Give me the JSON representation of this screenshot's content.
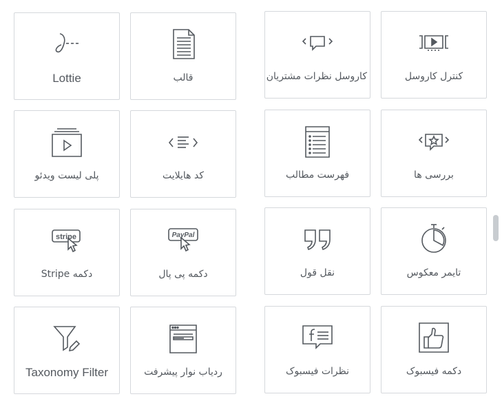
{
  "widgets": [
    {
      "label": "Lottie",
      "icon": "lottie-icon",
      "lang": "en"
    },
    {
      "label": "قالب",
      "icon": "document-icon",
      "lang": "fa"
    },
    {
      "label": "کاروسل نظرات مشتریان",
      "icon": "testimonial-carousel-icon",
      "lang": "fa"
    },
    {
      "label": "کنترل کاروسل",
      "icon": "media-carousel-icon",
      "lang": "fa"
    },
    {
      "label": "پلی لیست ویدئو",
      "icon": "video-playlist-icon",
      "lang": "fa"
    },
    {
      "label": "کد هایلایت",
      "icon": "code-highlight-icon",
      "lang": "fa"
    },
    {
      "label": "فهرست مطالب",
      "icon": "table-of-contents-icon",
      "lang": "fa"
    },
    {
      "label": "بررسی ها",
      "icon": "reviews-icon",
      "lang": "fa"
    },
    {
      "label": "دکمه Stripe",
      "icon": "stripe-button-icon",
      "lang": "fa",
      "badge": "stripe"
    },
    {
      "label": "دکمه پی پال",
      "icon": "paypal-button-icon",
      "lang": "fa",
      "badge": "PayPal"
    },
    {
      "label": "نقل قول",
      "icon": "blockquote-icon",
      "lang": "fa"
    },
    {
      "label": "تایمر معکوس",
      "icon": "countdown-timer-icon",
      "lang": "fa"
    },
    {
      "label": "Taxonomy Filter",
      "icon": "taxonomy-filter-icon",
      "lang": "en"
    },
    {
      "label": "ردیاب نوار پیشرفت",
      "icon": "progress-tracker-icon",
      "lang": "fa"
    },
    {
      "label": "نظرات فیسبوک",
      "icon": "facebook-comments-icon",
      "lang": "fa"
    },
    {
      "label": "دکمه فیسبوک",
      "icon": "facebook-button-icon",
      "lang": "fa"
    }
  ]
}
